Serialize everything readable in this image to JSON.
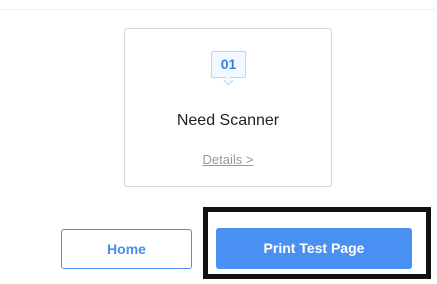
{
  "card": {
    "step_number": "01",
    "title": "Need Scanner",
    "details_link": "Details >"
  },
  "buttons": {
    "home_label": "Home",
    "print_label": "Print Test Page"
  },
  "colors": {
    "accent": "#4a90f2",
    "badge_text": "#3b7fdc",
    "highlight_frame": "#111111"
  }
}
